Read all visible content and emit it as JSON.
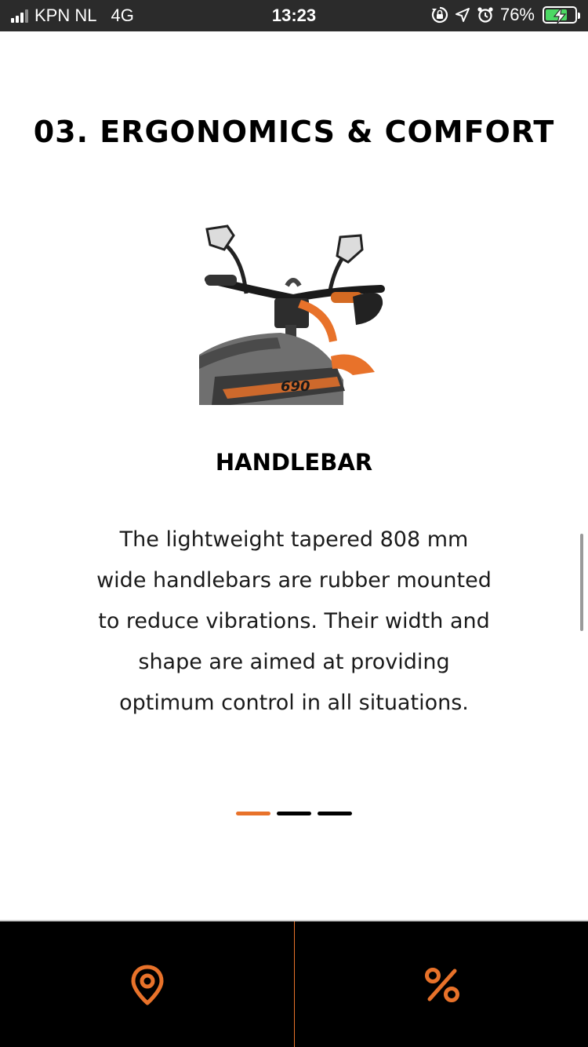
{
  "status_bar": {
    "carrier": "KPN NL",
    "network": "4G",
    "time": "13:23",
    "battery_percent_label": "76%",
    "battery_level": 0.76
  },
  "content": {
    "section_title": "03. ERGONOMICS & COMFORT",
    "feature_title": "HANDLEBAR",
    "feature_description_lines": [
      "The lightweight tapered 808 mm",
      "wide handlebars are rubber mounted",
      "to reduce vibrations. Their width and",
      "shape are aimed at providing",
      "optimum control in all situations."
    ],
    "bike_image_icon": "motorcycle-handlebar-image",
    "bike_badge_text": "690"
  },
  "pager": {
    "total": 3,
    "active_index": 0
  },
  "bottom_bar": {
    "left_icon": "location-pin-icon",
    "right_icon": "percent-icon"
  },
  "colors": {
    "accent": "#e8722a",
    "status_bar_bg": "#2b2b2b",
    "bottom_bar_bg": "#000000",
    "battery_green": "#4cd964"
  }
}
